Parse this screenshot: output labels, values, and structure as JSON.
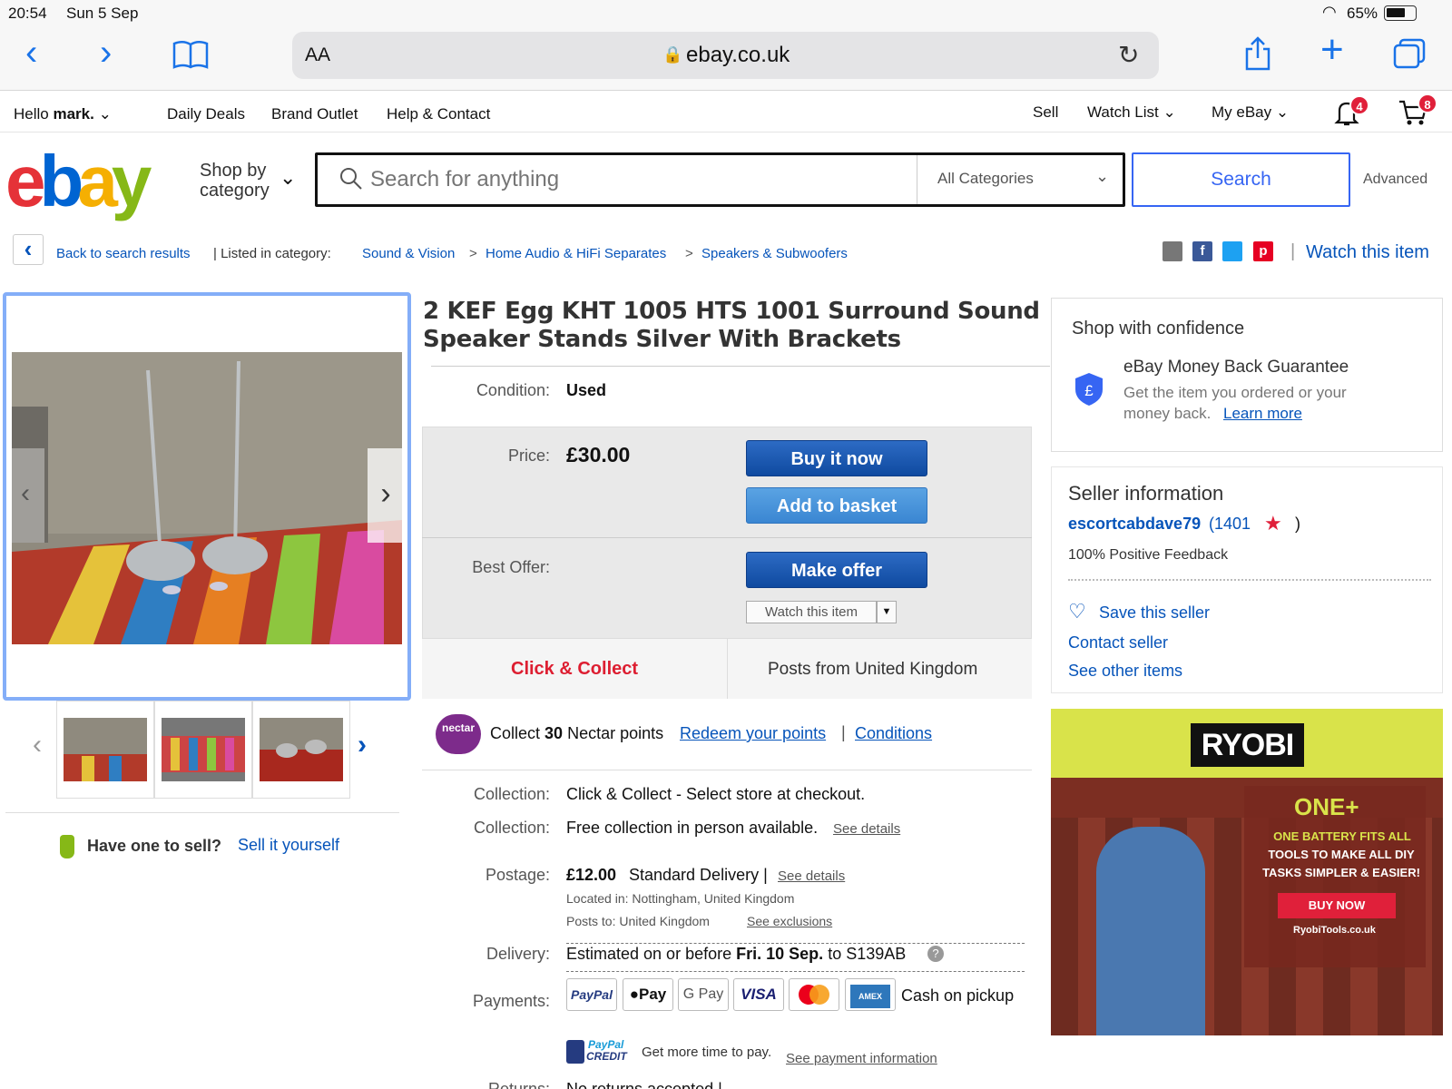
{
  "status_bar": {
    "time": "20:54",
    "date": "Sun 5 Sep",
    "battery": "65%"
  },
  "browser": {
    "aa_label": "AA",
    "url": "ebay.co.uk"
  },
  "top_nav": {
    "greeting": "Hello",
    "user": "mark.",
    "links": [
      "Daily Deals",
      "Brand Outlet",
      "Help & Contact"
    ],
    "sell": "Sell",
    "watch_list": "Watch List",
    "my_ebay": "My eBay",
    "notifications_count": "4",
    "basket_count": "8"
  },
  "header": {
    "shop_by": "Shop by",
    "category": "category",
    "search_placeholder": "Search for anything",
    "category_select": "All Categories",
    "search_button": "Search",
    "advanced": "Advanced"
  },
  "breadcrumb": {
    "back": "Back to search results",
    "listed_in": "| Listed in category:",
    "items": [
      "Sound & Vision",
      "Home Audio & HiFi Separates",
      "Speakers & Subwoofers"
    ],
    "watch": "Watch this item"
  },
  "listing": {
    "title": "2 KEF Egg KHT 1005 HTS 1001 Surround Sound Speaker Stands Silver With Brackets",
    "condition_label": "Condition:",
    "condition": "Used",
    "price_label": "Price:",
    "price": "£30.00",
    "buy_now": "Buy it now",
    "add_to_basket": "Add to basket",
    "best_offer_label": "Best Offer:",
    "make_offer": "Make offer",
    "watch_item": "Watch this item",
    "click_collect": "Click & Collect",
    "posts_from": "Posts from United Kingdom",
    "nectar_logo": "nectar",
    "nectar_collect": "Collect",
    "nectar_points": "30",
    "nectar_text": "Nectar points",
    "redeem": "Redeem your points",
    "conditions": "Conditions",
    "collection_label": "Collection:",
    "collection_1": "Click & Collect - Select store at checkout.",
    "collection_2": "Free collection in person available.",
    "see_details": "See details",
    "postage_label": "Postage:",
    "postage_price": "£12.00",
    "postage_type": "Standard Delivery |",
    "located_in": "Located in:  Nottingham, United Kingdom",
    "posts_to": "Posts to:  United Kingdom",
    "see_exclusions": "See exclusions",
    "delivery_label": "Delivery:",
    "delivery_pre": "Estimated on or before",
    "delivery_date": "Fri. 10 Sep.",
    "delivery_post": "to S139AB",
    "payments_label": "Payments:",
    "payment_icons": [
      "PayPal",
      "Pay",
      "G Pay",
      "VISA",
      "mastercard",
      "AMEX"
    ],
    "cash": "Cash on pickup",
    "paypal_credit_1": "PayPal",
    "paypal_credit_2": "CREDIT",
    "more_time": "Get more time to pay.",
    "see_payment": "See payment information",
    "returns_label": "Returns:",
    "returns": "No returns accepted |"
  },
  "sell_promo": {
    "question": "Have one to sell?",
    "link": "Sell it yourself"
  },
  "confidence": {
    "title": "Shop with confidence",
    "guarantee": "eBay Money Back Guarantee",
    "desc_1": "Get the item you ordered or your",
    "desc_2": "money back.",
    "learn_more": "Learn more"
  },
  "seller": {
    "title": "Seller information",
    "name": "escortcabdave79",
    "feedback_count": "(1401",
    "close_paren": ")",
    "positive": "100% Positive Feedback",
    "save": "Save this seller",
    "contact": "Contact seller",
    "other": "See other items"
  },
  "ad": {
    "brand": "RYOBI",
    "one_plus": "ONE+",
    "line1": "ONE BATTERY FITS ALL",
    "line2": "TOOLS TO MAKE ALL DIY",
    "line3": "TASKS SIMPLER & EASIER!",
    "cta": "BUY NOW",
    "site": "RyobiTools.co.uk"
  }
}
